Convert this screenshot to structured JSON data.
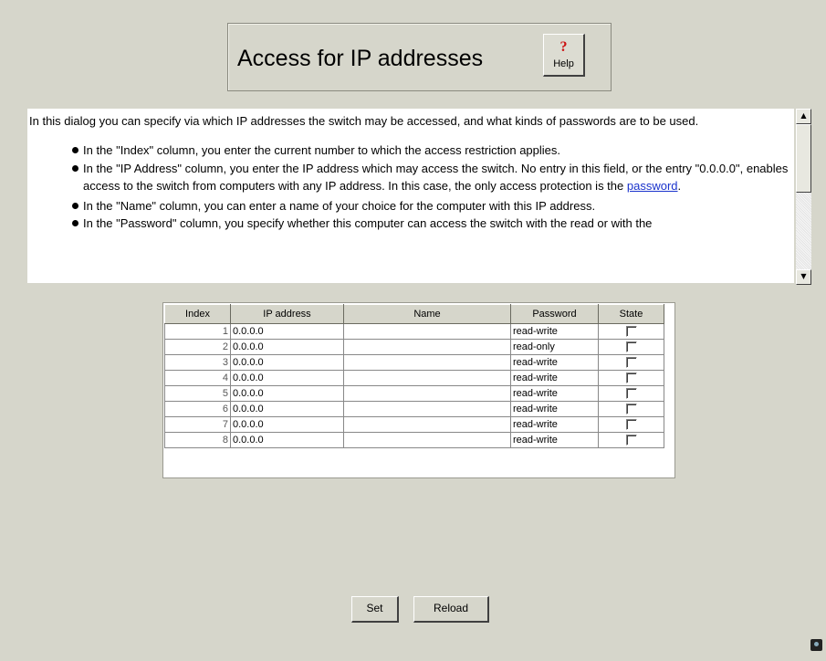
{
  "header": {
    "title": "Access for IP addresses",
    "help_label": "Help",
    "help_icon": "question-mark"
  },
  "description": {
    "intro": "In this dialog you can specify via which IP addresses the switch may be accessed, and what kinds of passwords are to be used.",
    "bullets": [
      "In the \"Index\" column, you enter the current number to which the access restriction applies.",
      "In the \"IP Address\" column, you enter the IP address which may access the switch. No entry in this field, or the entry \"0.0.0.0\", enables access to the switch from computers with any IP address. In this case, the only access protection is the ",
      "In the \"Name\" column, you can enter a name of your choice for the computer with this IP address.",
      "In the \"Password\" column, you specify whether this computer can access the switch with the read or with the"
    ],
    "link_text": "password",
    "link_suffix": "."
  },
  "table": {
    "columns": [
      "Index",
      "IP address",
      "Name",
      "Password",
      "State"
    ],
    "rows": [
      {
        "index": "1",
        "ip": "0.0.0.0",
        "name": "",
        "password": "read-write",
        "state": false
      },
      {
        "index": "2",
        "ip": "0.0.0.0",
        "name": "",
        "password": "read-only",
        "state": false
      },
      {
        "index": "3",
        "ip": "0.0.0.0",
        "name": "",
        "password": "read-write",
        "state": false
      },
      {
        "index": "4",
        "ip": "0.0.0.0",
        "name": "",
        "password": "read-write",
        "state": false
      },
      {
        "index": "5",
        "ip": "0.0.0.0",
        "name": "",
        "password": "read-write",
        "state": false
      },
      {
        "index": "6",
        "ip": "0.0.0.0",
        "name": "",
        "password": "read-write",
        "state": false
      },
      {
        "index": "7",
        "ip": "0.0.0.0",
        "name": "",
        "password": "read-write",
        "state": false
      },
      {
        "index": "8",
        "ip": "0.0.0.0",
        "name": "",
        "password": "read-write",
        "state": false
      }
    ]
  },
  "buttons": {
    "set": "Set",
    "reload": "Reload"
  },
  "colors": {
    "background": "#d6d6cb",
    "link": "#1a33cc",
    "help_icon": "#cc1111"
  }
}
